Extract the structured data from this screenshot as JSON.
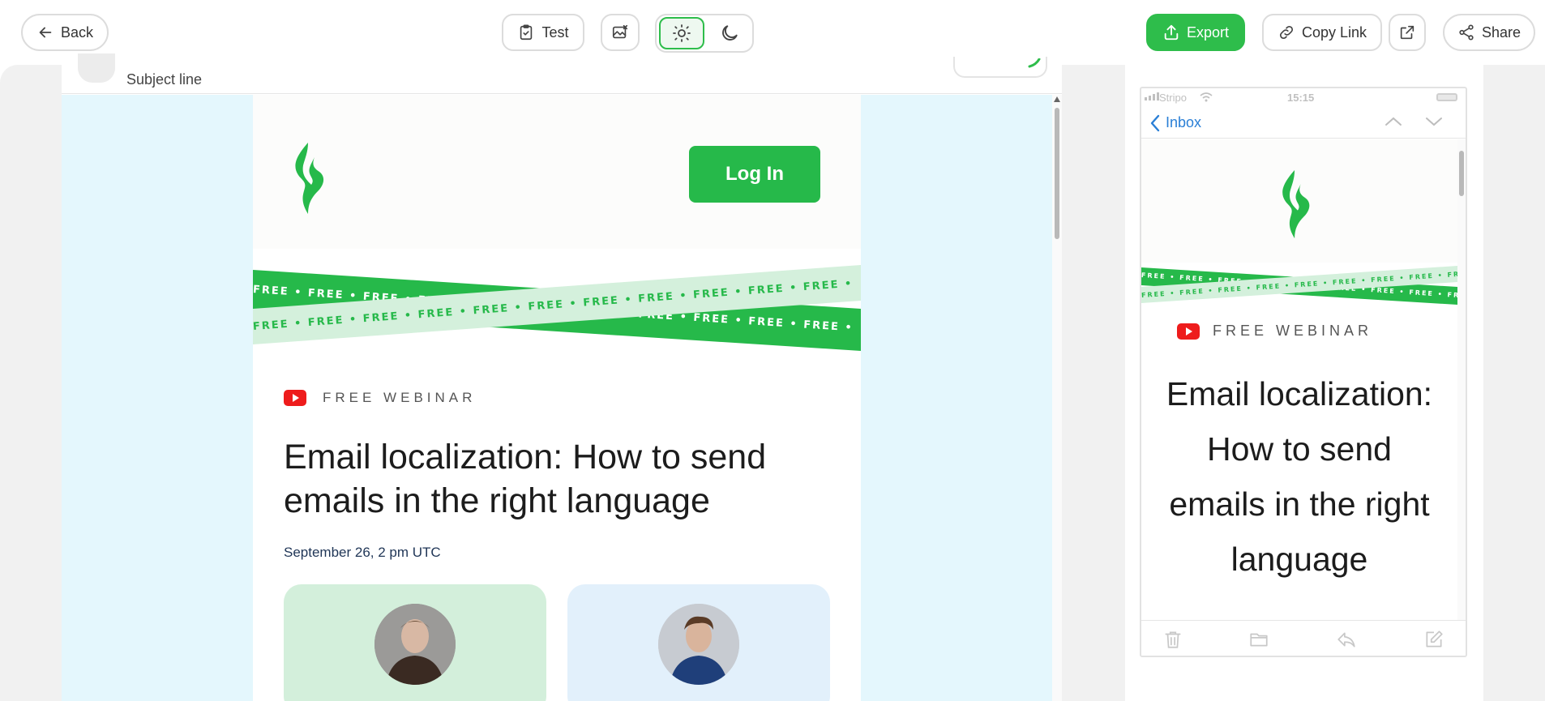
{
  "toolbar": {
    "back_label": "Back",
    "test_label": "Test",
    "export_label": "Export",
    "copy_link_label": "Copy Link",
    "share_label": "Share"
  },
  "editor": {
    "subject_label": "Subject line"
  },
  "email": {
    "login_label": "Log In",
    "ribbon_text": "FREE • FREE • FREE • FREE • FREE • FREE • FREE • FREE • FREE • FREE • FREE • FREE • FREE • FREE",
    "webinar_label": "FREE WEBINAR",
    "headline": "Email localization: How to send emails in the right language",
    "date": "September 26, 2 pm UTC"
  },
  "preview": {
    "carrier": "Stripo",
    "time": "15:15",
    "inbox_label": "Inbox",
    "headline": "Email localization: How to send emails in the right language"
  },
  "colors": {
    "brand_green": "#2ebd4b",
    "canvas_bg": "#e4f7fd",
    "ribbon_dark": "#26b94a",
    "ribbon_light": "#d4f0dc",
    "link_blue": "#2a7fd6",
    "youtube_red": "#ee1c1c"
  }
}
